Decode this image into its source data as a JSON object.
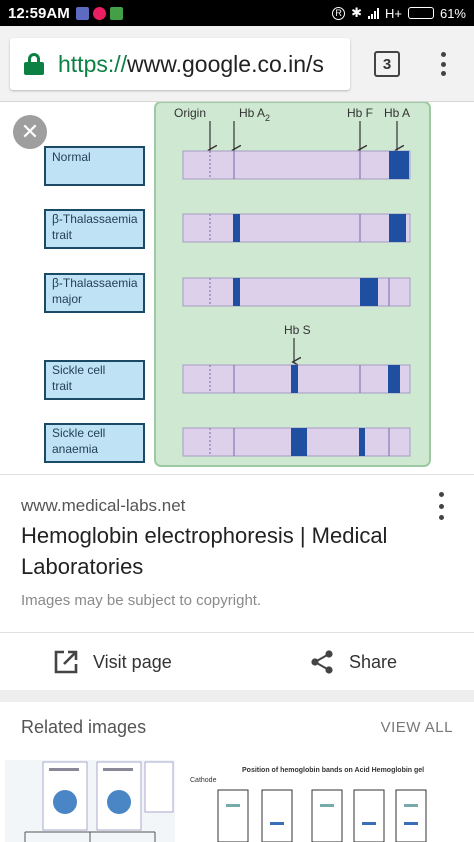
{
  "status_bar": {
    "time": "12:59AM",
    "network": "H+",
    "battery_percent": "61%",
    "battery_level": 0.61,
    "notification_colors": [
      "#5c6bc0",
      "#e91e63",
      "#43a047"
    ]
  },
  "browser": {
    "url_scheme": "https://",
    "url_host": "www.google.co.in/s",
    "tab_count": "3",
    "secure_color": "#0b8043"
  },
  "image": {
    "markers": {
      "origin": "Origin",
      "hba2": "Hb A",
      "hba2_sub": "2",
      "hbf": "Hb F",
      "hba": "Hb A",
      "hbs": "Hb S"
    },
    "samples": [
      {
        "line1": "Normal",
        "line2": ""
      },
      {
        "line1": "β-Thalassaemia",
        "line2": "trait"
      },
      {
        "line1": "β-Thalassaemia",
        "line2": "major"
      },
      {
        "line1": "Sickle cell",
        "line2": "trait"
      },
      {
        "line1": "Sickle cell",
        "line2": "anaemia"
      }
    ],
    "colors": {
      "gel": "#cfe8d2",
      "lane": "#dcd0ea",
      "band": "#1f4fa0",
      "label_box": "#bfe3f4"
    }
  },
  "result": {
    "source": "www.medical-labs.net",
    "title": "Hemoglobin electrophoresis | Medical Laboratories",
    "copyright": "Images may be subject to copyright.",
    "visit_label": "Visit page",
    "share_label": "Share"
  },
  "related": {
    "label": "Related images",
    "view_all": "VIEW ALL",
    "thumb2_title": "Position of hemoglobin bands on Acid Hemoglobin gel",
    "thumb2_cathode": "Cathode"
  }
}
